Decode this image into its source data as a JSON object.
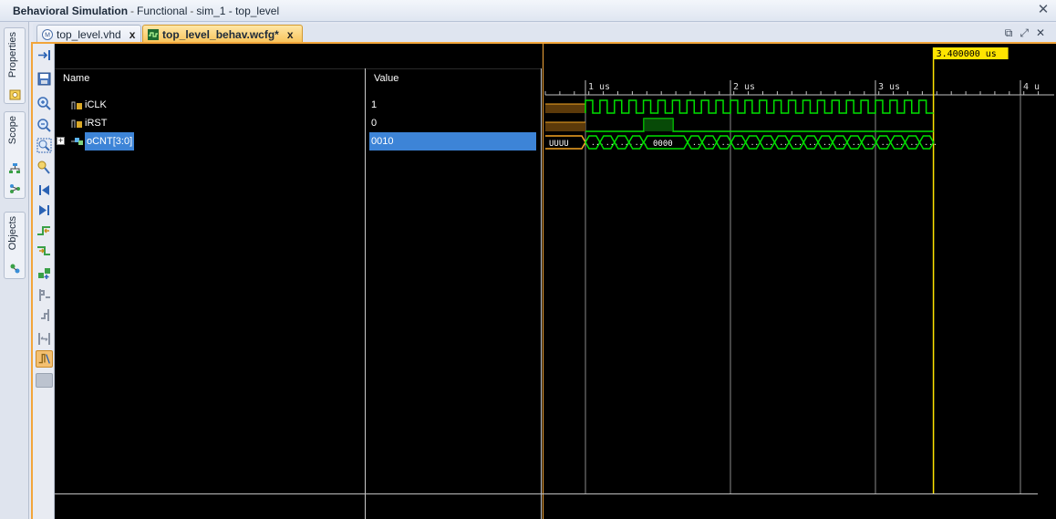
{
  "title": {
    "mode": "Behavioral Simulation",
    "sep1": "-",
    "type": "Functional",
    "sep2": "-",
    "context": "sim_1 - top_level"
  },
  "side_tabs": [
    {
      "label": "Properties",
      "icon": "properties-icon"
    },
    {
      "label": "Scope",
      "icon": "scope-icon"
    },
    {
      "label": "Objects",
      "icon": "objects-icon"
    }
  ],
  "tabs": [
    {
      "label": "top_level.vhd",
      "close": "x",
      "active": false,
      "icon": "vhdl-file-icon"
    },
    {
      "label": "top_level_behav.wcfg*",
      "close": "x",
      "active": true,
      "icon": "waveform-icon"
    }
  ],
  "window_controls": {
    "restore": "⧉",
    "maximize": "⤢",
    "close": "✕"
  },
  "columns": {
    "name": "Name",
    "value": "Value"
  },
  "signals": [
    {
      "name": "iCLK",
      "value": "1",
      "icon": "bit-signal-icon",
      "selected": false
    },
    {
      "name": "iRST",
      "value": "0",
      "icon": "bit-signal-icon",
      "selected": false
    },
    {
      "name": "oCNT[3:0]",
      "value": "0010",
      "icon": "bus-signal-icon",
      "selected": true,
      "expander": "+"
    }
  ],
  "toolbar_icons": [
    "zoom-fit-icon",
    "save-icon",
    "zoom-in-icon",
    "zoom-out-icon",
    "zoom-full-icon",
    "cursor-center-icon",
    "go-to-start-icon",
    "go-to-end-icon",
    "prev-transition-icon",
    "next-transition-icon",
    "add-marker-icon",
    "prev-marker-icon",
    "next-marker-icon",
    "swap-cursors-icon",
    "snap-to-transition-icon",
    "divider-icon"
  ],
  "timeline": {
    "ticks": [
      "1 us",
      "2 us",
      "3 us",
      "4 u"
    ],
    "cursor_label": "3.400000 us",
    "cursor_time_us": 3.4,
    "colors": {
      "wave": "#00e000",
      "cursor": "#ffe400",
      "undefined": "#f5a623",
      "grid": "#c0c0c0"
    }
  },
  "waves": {
    "oCNT_labels": {
      "initial": "UUUU",
      "after_reset": "0000",
      "collapsed": "..."
    }
  }
}
